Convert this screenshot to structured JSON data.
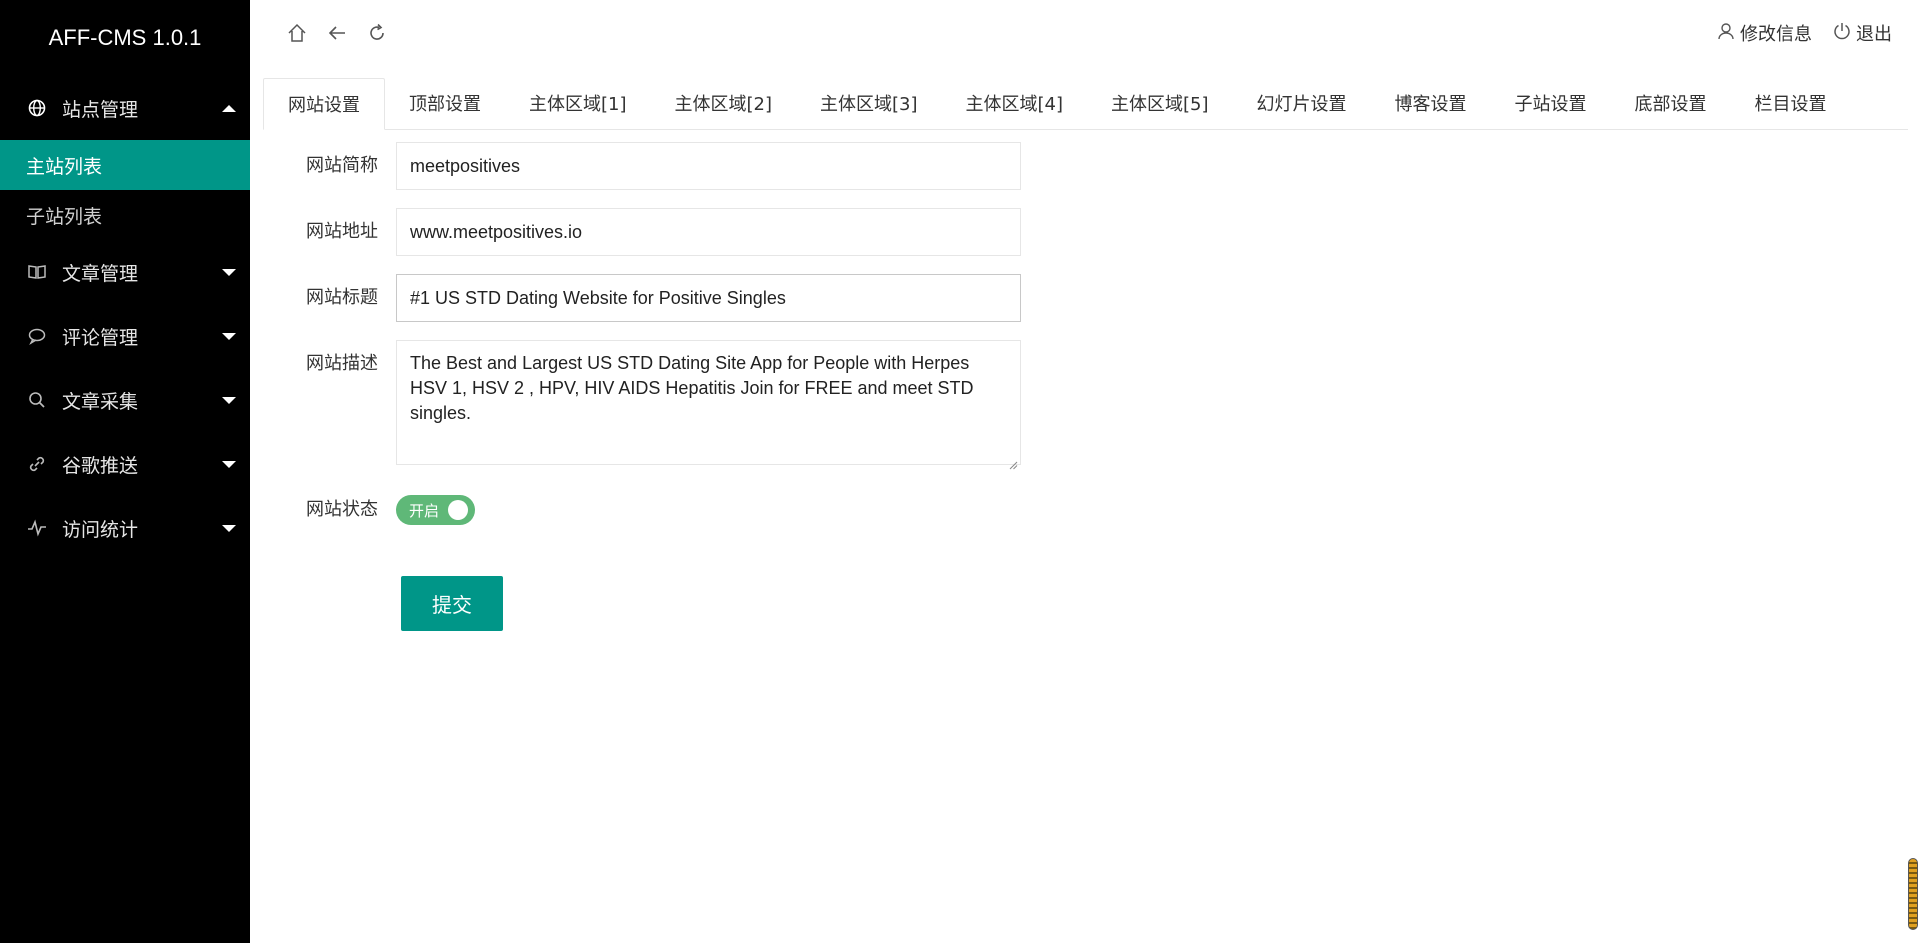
{
  "app": {
    "title": "AFF-CMS 1.0.1"
  },
  "sidebar": {
    "groups": [
      {
        "label": "站点管理",
        "icon": "globe-icon",
        "expanded": true
      },
      {
        "label": "文章管理",
        "icon": "book-icon",
        "expanded": false
      },
      {
        "label": "评论管理",
        "icon": "comment-icon",
        "expanded": false
      },
      {
        "label": "文章采集",
        "icon": "search-icon",
        "expanded": false
      },
      {
        "label": "谷歌推送",
        "icon": "link-icon",
        "expanded": false
      },
      {
        "label": "访问统计",
        "icon": "pulse-icon",
        "expanded": false
      }
    ],
    "subitems": [
      {
        "label": "主站列表",
        "active": true
      },
      {
        "label": "子站列表",
        "active": false
      }
    ]
  },
  "topbar": {
    "icons": [
      "home-icon",
      "back-arrow-icon",
      "refresh-icon"
    ],
    "profile_label": "修改信息",
    "logout_label": "退出"
  },
  "tabs": [
    {
      "label": "网站设置",
      "active": true
    },
    {
      "label": "顶部设置"
    },
    {
      "label": "主体区域[1]"
    },
    {
      "label": "主体区域[2]"
    },
    {
      "label": "主体区域[3]"
    },
    {
      "label": "主体区域[4]"
    },
    {
      "label": "主体区域[5]"
    },
    {
      "label": "幻灯片设置"
    },
    {
      "label": "博客设置"
    },
    {
      "label": "子站设置"
    },
    {
      "label": "底部设置"
    },
    {
      "label": "栏目设置"
    }
  ],
  "form": {
    "site_name": {
      "label": "网站简称",
      "value": "meetpositives"
    },
    "site_url": {
      "label": "网站地址",
      "value": "www.meetpositives.io"
    },
    "site_title": {
      "label": "网站标题",
      "value": "#1 US STD Dating Website for Positive Singles"
    },
    "site_desc": {
      "label": "网站描述",
      "value": "The Best and Largest US STD Dating Site App for People with Herpes HSV 1, HSV 2 , HPV, HIV AIDS Hepatitis Join for FREE and meet STD singles."
    },
    "site_status": {
      "label": "网站状态",
      "switch_text": "开启",
      "on": true
    },
    "submit_label": "提交"
  },
  "colors": {
    "accent": "#009688",
    "switch_on": "#5fb878",
    "sidebar_bg": "#000000"
  }
}
